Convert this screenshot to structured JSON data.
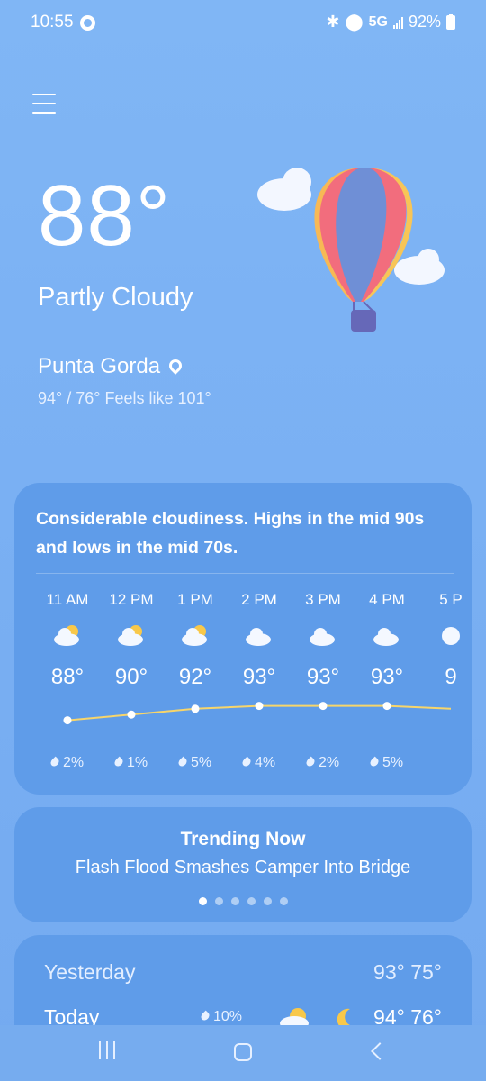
{
  "status_bar": {
    "time": "10:55",
    "network": "5G",
    "battery": "92%"
  },
  "current": {
    "temperature": "88°",
    "condition": "Partly Cloudy",
    "location": "Punta Gorda",
    "hi_lo_feels": "94° / 76° Feels like 101°"
  },
  "forecast_card": {
    "summary": "Considerable cloudiness. Highs in the mid 90s and lows in the mid 70s.",
    "hours": [
      {
        "time": "11 AM",
        "temp": "88°",
        "precip": "2%",
        "icon": "partly-sunny-icon"
      },
      {
        "time": "12 PM",
        "temp": "90°",
        "precip": "1%",
        "icon": "partly-sunny-icon"
      },
      {
        "time": "1 PM",
        "temp": "92°",
        "precip": "5%",
        "icon": "partly-sunny-icon"
      },
      {
        "time": "2 PM",
        "temp": "93°",
        "precip": "4%",
        "icon": "cloud-icon"
      },
      {
        "time": "3 PM",
        "temp": "93°",
        "precip": "2%",
        "icon": "cloud-icon"
      },
      {
        "time": "4 PM",
        "temp": "93°",
        "precip": "5%",
        "icon": "cloud-icon"
      },
      {
        "time": "5 P",
        "temp": "9",
        "precip": "",
        "icon": "moon-icon"
      }
    ],
    "temp_values": [
      88,
      90,
      92,
      93,
      93,
      93,
      92
    ]
  },
  "trending": {
    "heading": "Trending Now",
    "headline": "Flash Flood Smashes Camper Into Bridge",
    "pages": 6,
    "active_page": 1
  },
  "daily": {
    "yesterday_label": "Yesterday",
    "yesterday_range": "93° 75°",
    "today_label": "Today",
    "today_precip": "10%",
    "today_range": "94° 76°"
  },
  "colors": {
    "background": "#7ab0f3",
    "card": "#5f9ce9",
    "temp_line": "#f7d56a"
  }
}
